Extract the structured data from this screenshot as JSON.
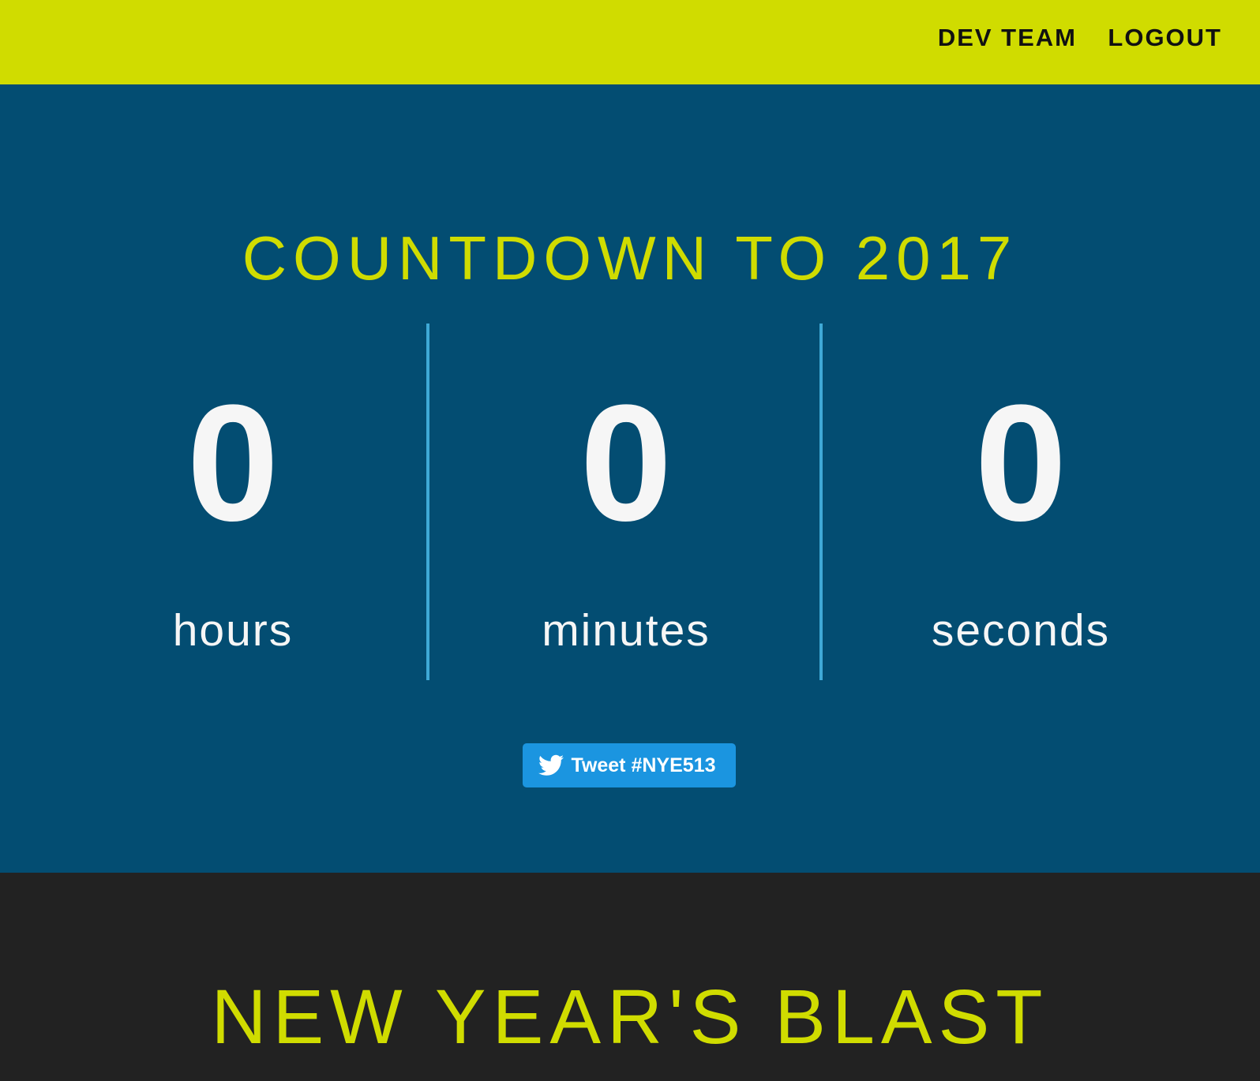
{
  "colors": {
    "accent": "#d0dc00",
    "hero_background": "#034d72",
    "footer_background": "#222222",
    "divider": "#3fa9d6",
    "twitter": "#1b95e0"
  },
  "nav": {
    "items": [
      {
        "label": "DEV TEAM"
      },
      {
        "label": "LOGOUT"
      }
    ]
  },
  "countdown": {
    "title": "COUNTDOWN TO 2017",
    "units": [
      {
        "value": "0",
        "label": "hours"
      },
      {
        "value": "0",
        "label": "minutes"
      },
      {
        "value": "0",
        "label": "seconds"
      }
    ]
  },
  "tweet": {
    "icon": "twitter-bird-icon",
    "label": "Tweet #NYE513"
  },
  "blast": {
    "title": "NEW YEAR'S BLAST"
  }
}
